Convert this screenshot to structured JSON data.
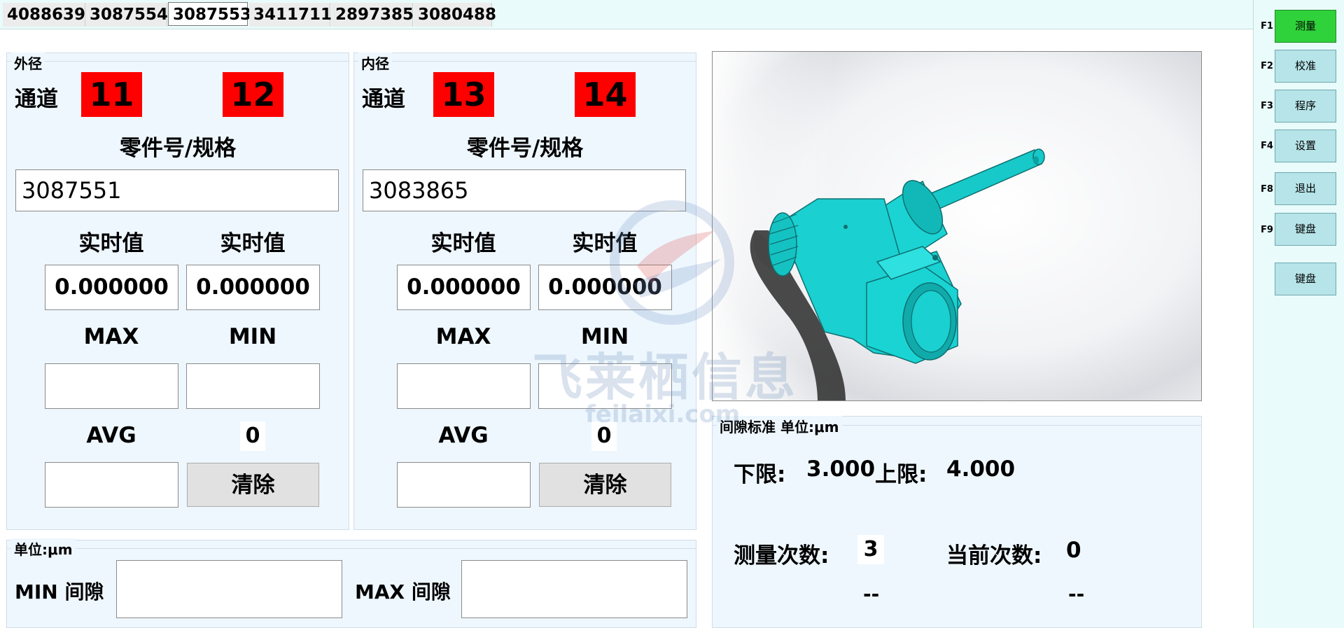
{
  "tabs": [
    "4088639",
    "3087554",
    "3087553",
    "3411711",
    "2897385",
    "3080488"
  ],
  "active_tab_index": 2,
  "outer": {
    "title": "外径",
    "channel_label": "通道",
    "channel_a": "11",
    "channel_b": "12",
    "part_label": "零件号/规格",
    "part_value": "3087551",
    "realtime_label_1": "实时值",
    "realtime_label_2": "实时值",
    "realtime_value_1": "0.000000",
    "realtime_value_2": "0.000000",
    "max_label": "MAX",
    "min_label": "MIN",
    "avg_label": "AVG",
    "count_value": "0",
    "clear_label": "清除"
  },
  "inner": {
    "title": "内径",
    "channel_label": "通道",
    "channel_a": "13",
    "channel_b": "14",
    "part_label": "零件号/规格",
    "part_value": "3083865",
    "realtime_label_1": "实时值",
    "realtime_label_2": "实时值",
    "realtime_value_1": "0.000000",
    "realtime_value_2": "0.000000",
    "max_label": "MAX",
    "min_label": "MIN",
    "avg_label": "AVG",
    "count_value": "0",
    "clear_label": "清除"
  },
  "gap": {
    "title": "单位:μm",
    "min_label": "MIN 间隙",
    "max_label": "MAX 间隙"
  },
  "standard": {
    "title": "间隙标准  单位:μm",
    "lower_label": "下限:",
    "lower_value": "3.000",
    "upper_label": "上限:",
    "upper_value": "4.000",
    "measure_count_label": "测量次数:",
    "measure_count_value": "3",
    "current_count_label": "当前次数:",
    "current_count_value": "0",
    "dash_1": "--",
    "dash_2": "--"
  },
  "sidebar": {
    "items": [
      {
        "key": "F1",
        "label": "测量",
        "active": true
      },
      {
        "key": "F2",
        "label": "校准",
        "active": false
      },
      {
        "key": "F3",
        "label": "程序",
        "active": false
      },
      {
        "key": "F4",
        "label": "设置",
        "active": false
      },
      {
        "key": "F8",
        "label": "退出",
        "active": false
      },
      {
        "key": "F9",
        "label": "键盘",
        "active": false
      }
    ],
    "extra_label": "键盘"
  },
  "watermark": {
    "cn": "飞莱栖信息",
    "en": "feilaixi.com"
  },
  "colors": {
    "channel_red": "#ff0000",
    "active_green": "#2fd23a",
    "sidebar_button": "#b6e4e8",
    "part_cyan": "#17c9c9",
    "panel_bg": "#eef7fe"
  }
}
